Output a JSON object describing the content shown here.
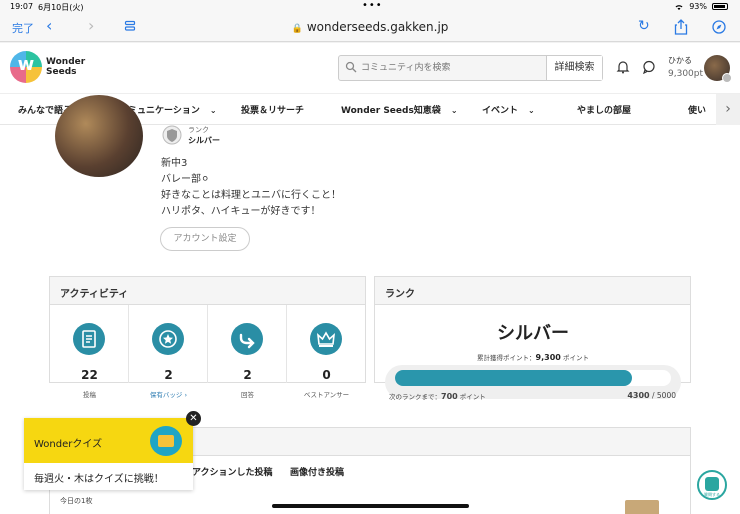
{
  "status": {
    "time": "19:07",
    "date": "6月10日(火)",
    "battery": "93%"
  },
  "browser": {
    "done_label": "完了",
    "url": "wonderseeds.gakken.jp"
  },
  "header": {
    "logo_line1": "Wonder",
    "logo_line2": "Seeds",
    "search_placeholder": "コミュニティ内を検索",
    "advanced_search": "詳細検索",
    "user_name": "ひかる",
    "user_points": "9,300pt"
  },
  "nav": {
    "items": [
      {
        "label": "みんなで語ろう",
        "has_menu": false
      },
      {
        "label": "コミュニケーション",
        "has_menu": true
      },
      {
        "label": "投票＆リサーチ",
        "has_menu": false
      },
      {
        "label": "Wonder Seeds知恵袋",
        "has_menu": true
      },
      {
        "label": "イベント",
        "has_menu": true
      },
      {
        "label": "やましの部屋",
        "has_menu": false
      },
      {
        "label": "使い",
        "has_menu": false
      }
    ]
  },
  "profile": {
    "rank_label": "ランク",
    "rank_value": "シルバー",
    "bio": [
      "新中3",
      "バレー部⚪",
      "好きなことは料理とユニバに行くこと！",
      "ハリポタ、ハイキューが好きです！"
    ],
    "account_button": "アカウント設定"
  },
  "activity": {
    "title": "アクティビティ",
    "items": [
      {
        "icon": "document-icon",
        "value": "22",
        "label": "投稿"
      },
      {
        "icon": "badge-star-icon",
        "value": "2",
        "label": "保有バッジ ›"
      },
      {
        "icon": "reply-arrow-icon",
        "value": "2",
        "label": "回答"
      },
      {
        "icon": "crown-icon",
        "value": "0",
        "label": "ベストアンサー"
      }
    ]
  },
  "rank_card": {
    "title": "ランク",
    "rank": "シルバー",
    "total_label": "累計獲得ポイント：",
    "total_value": "9,300",
    "total_unit": "ポイント",
    "next_label": "次のランクまで：",
    "next_value": "700",
    "next_unit": "ポイント",
    "progress_current": "4300",
    "progress_max": "/ 5000",
    "progress_fraction": 0.86,
    "bar_color": "#2a96ac"
  },
  "posts": {
    "tabs": [
      "アクションした投稿",
      "画像付き投稿"
    ],
    "today_label": "今日の1枚"
  },
  "quiz": {
    "title": "Wonderクイズ",
    "body": "毎週火・木はクイズに挑戦！",
    "close": "✕"
  },
  "float_button_label": "質問する"
}
